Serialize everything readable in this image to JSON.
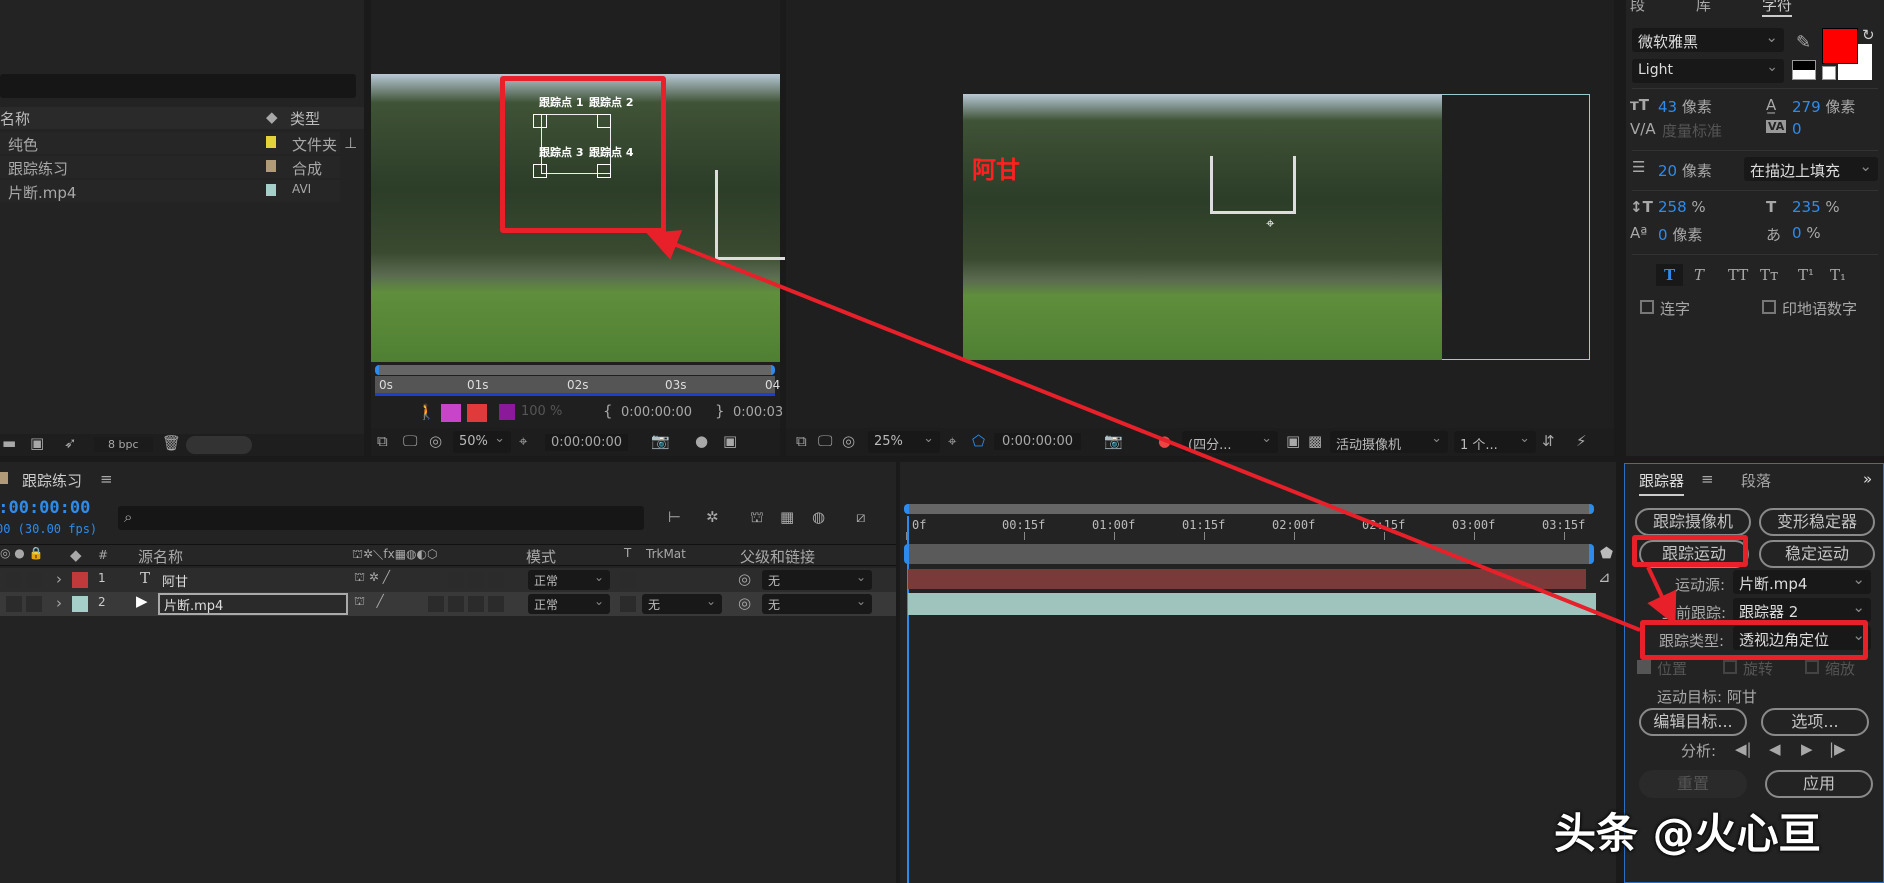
{
  "project": {
    "columns": {
      "name": "名称",
      "type": "类型"
    },
    "items": [
      {
        "name": "纯色",
        "type": "文件夹",
        "color": "#e3d23a"
      },
      {
        "name": "跟踪练习",
        "type": "合成",
        "color": "#b09a78"
      },
      {
        "name": "片断.mp4",
        "type": "AVI",
        "color": "#a6cfc9"
      }
    ],
    "bpc": "8 bpc"
  },
  "footage": {
    "track_labels": [
      "跟踪点 1",
      "跟踪点 2",
      "跟踪点 3",
      "跟踪点 4"
    ],
    "ruler": [
      "0s",
      "01s",
      "02s",
      "03s",
      "04"
    ],
    "opacity": "100 %",
    "in_time": "0:00:00:00",
    "out_time": "0:00:03",
    "zoom": "50%",
    "timecode": "0:00:00:00"
  },
  "comp": {
    "text_layer": "阿甘",
    "zoom": "25%",
    "timecode": "0:00:00:00",
    "resolution": "(四分...",
    "camera": "活动摄像机",
    "views": "1 个..."
  },
  "character": {
    "tabs": [
      "段",
      "库",
      "字符"
    ],
    "font": "微软雅黑",
    "style": "Light",
    "fill_color": "#ff0000",
    "size": "43",
    "size_unit": "像素",
    "leading": "279",
    "leading_unit": "像素",
    "kerning": "度量标准",
    "tracking": "0",
    "stroke": "20",
    "stroke_unit": "像素",
    "stroke_mode": "在描边上填充",
    "vscale": "258",
    "hscale": "235",
    "pct": "%",
    "baseline": "0",
    "baseline_unit": "像素",
    "tsume": "0",
    "styles": [
      "T",
      "T",
      "TT",
      "Tт",
      "T¹",
      "T₁"
    ],
    "ligatures": "连字",
    "hindi": "印地语数字"
  },
  "timeline": {
    "tab": "跟踪练习",
    "timecode": "0:00:00:00",
    "fps": "00 (30.00 fps)",
    "headers": {
      "name": "源名称",
      "mode": "模式",
      "t": "T",
      "trkmat": "TrkMat",
      "parent": "父级和链接",
      "num": "#"
    },
    "layers": [
      {
        "num": "1",
        "name": "阿甘",
        "mode": "正常",
        "trkmat": "",
        "parent": "无",
        "color": "#c0393b",
        "bar": "#7a3a3a"
      },
      {
        "num": "2",
        "name": "片断.mp4",
        "mode": "正常",
        "trkmat": "无",
        "parent": "无",
        "color": "#a6cfc9",
        "bar": "#9fc3bd"
      }
    ],
    "ruler": [
      "0f",
      "00:15f",
      "01:00f",
      "01:15f",
      "02:00f",
      "02:15f",
      "03:00f",
      "03:15f"
    ]
  },
  "tracker": {
    "tabs": [
      "跟踪器",
      "段落"
    ],
    "track_camera": "跟踪摄像机",
    "warp_stabilizer": "变形稳定器",
    "track_motion": "跟踪运动",
    "stabilize_motion": "稳定运动",
    "source_label": "运动源:",
    "source": "片断.mp4",
    "current_label": "当前跟踪:",
    "current": "跟踪器 2",
    "type_label": "跟踪类型:",
    "type": "透视边角定位",
    "position": "位置",
    "rotation": "旋转",
    "scale": "缩放",
    "target": "运动目标: 阿甘",
    "edit_target": "编辑目标...",
    "options": "选项...",
    "analyze": "分析:",
    "reset": "重置",
    "apply": "应用"
  },
  "watermark": "头条 @火心亘",
  "annotation_color": "#e8202a"
}
